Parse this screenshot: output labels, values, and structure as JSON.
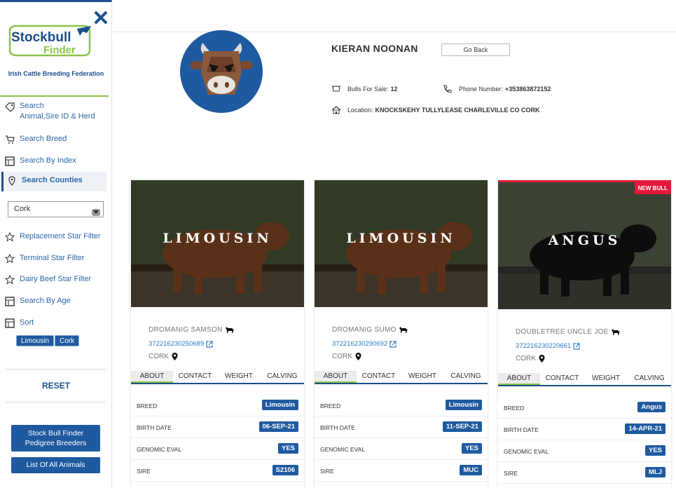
{
  "sidebar": {
    "logo_text_1": "Stockbull",
    "logo_text_2": "Finder",
    "org": "Irish Cattle Breeding Federation",
    "menu": [
      {
        "label": "Search\nAnimal,Sire ID & Herd",
        "icon": "tag-icon"
      },
      {
        "label": "Search Breed",
        "icon": "cart-icon"
      },
      {
        "label": "Search By Index",
        "icon": "table-icon"
      },
      {
        "label": "Search Counties",
        "icon": "map-pin-icon"
      },
      {
        "label": "Replacement Star Filter",
        "icon": "star-icon"
      },
      {
        "label": "Terminal Star Filter",
        "icon": "star-icon"
      },
      {
        "label": "Dairy Beef Star Filter",
        "icon": "star-icon"
      },
      {
        "label": "Search By Age",
        "icon": "table-icon"
      },
      {
        "label": "Sort",
        "icon": "table-icon"
      }
    ],
    "county_selected": "Cork",
    "filter_tags": [
      "Limousin",
      "Cork"
    ],
    "reset": "RESET",
    "btn_pedigree_1": "Stock Bull Finder",
    "btn_pedigree_2": "Pedigree Breeders",
    "btn_all": "List Of All Animals"
  },
  "breeder": {
    "name": "KIERAN NOONAN",
    "go_back": "Go Back",
    "bulls_label": "Bulls For Sale:",
    "bulls_value": "12",
    "phone_label": "Phone Number:",
    "phone_value": "+353863872152",
    "location_label": "Location:",
    "location_value": "KNOCKSKEHY TULLYLEASE CHARLEVILLE CO CORK"
  },
  "tabs": [
    "ABOUT",
    "CONTACT",
    "WEIGHT",
    "CALVING"
  ],
  "row_labels": [
    "BREED",
    "BIRTH DATE",
    "GENOMIC EVAL",
    "SIRE"
  ],
  "cards": [
    {
      "breed_title": "LIMOUSIN",
      "name": "DROMANIG SAMSON",
      "tag": "372216230250689",
      "county": "CORK",
      "breed": "Limousin",
      "birth": "06-SEP-21",
      "genomic": "YES",
      "sire": "S2106",
      "new": ""
    },
    {
      "breed_title": "LIMOUSIN",
      "name": "DROMANIG SUMO",
      "tag": "372216230290692",
      "county": "CORK",
      "breed": "Limousin",
      "birth": "11-SEP-21",
      "genomic": "YES",
      "sire": "MUC",
      "new": ""
    },
    {
      "breed_title": "ANGUS",
      "name": "DOUBLETREE UNCLE JOE",
      "tag": "372216230220661",
      "county": "CORK",
      "breed": "Angus",
      "birth": "14-APR-21",
      "genomic": "YES",
      "sire": "MLJ",
      "new": "NEW BULL"
    }
  ],
  "colors": {
    "brand_blue": "#1f5aa0",
    "accent_green": "#8bc34a",
    "new_red": "#e3193b"
  }
}
